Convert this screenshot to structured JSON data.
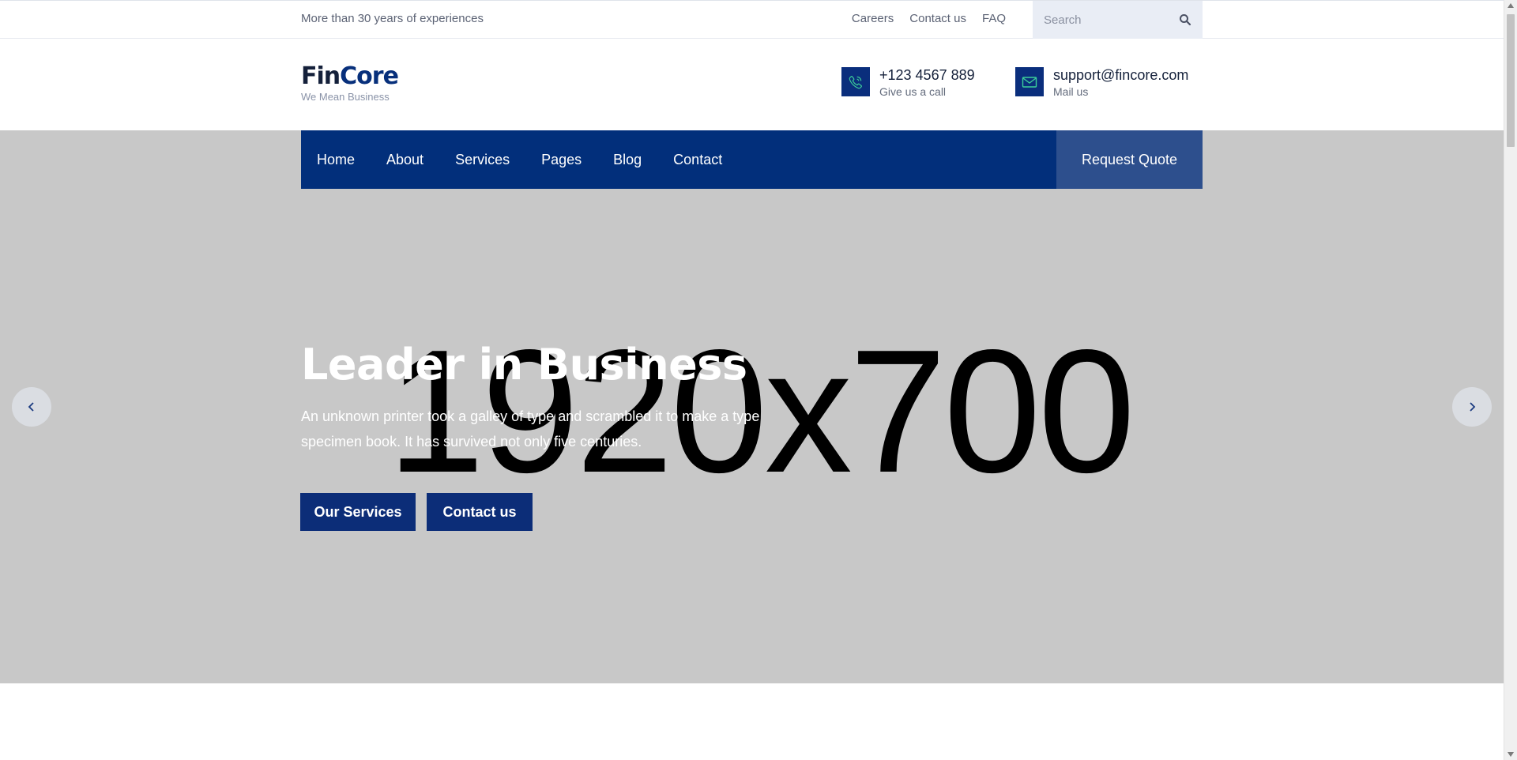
{
  "topbar": {
    "tagline": "More than 30 years of experiences",
    "links": [
      "Careers",
      "Contact us",
      "FAQ"
    ],
    "search_placeholder": "Search"
  },
  "header": {
    "logo": {
      "part1": "Fin",
      "part2": "Core",
      "slogan": "We Mean Business"
    },
    "phone": {
      "value": "+123 4567 889",
      "label": "Give us a call"
    },
    "email": {
      "value": "support@fincore.com",
      "label": "Mail us"
    }
  },
  "nav": {
    "items": [
      "Home",
      "About",
      "Services",
      "Pages",
      "Blog",
      "Contact"
    ],
    "cta": "Request Quote"
  },
  "hero": {
    "placeholder_text": "1920x700",
    "title": "Leader in Business",
    "text": "An unknown printer took a galley of type and scrambled it to make a type specimen book. It has survived not only five centuries.",
    "buttons": [
      "Our Services",
      "Contact us"
    ]
  },
  "colors": {
    "primary": "#022f7b",
    "cta": "#2d4f8d",
    "hero_bg": "#c8c8c8",
    "search_bg": "#e9edf5"
  },
  "icons": [
    "search-icon",
    "phone-icon",
    "mail-icon",
    "chevron-left-icon",
    "chevron-right-icon"
  ]
}
